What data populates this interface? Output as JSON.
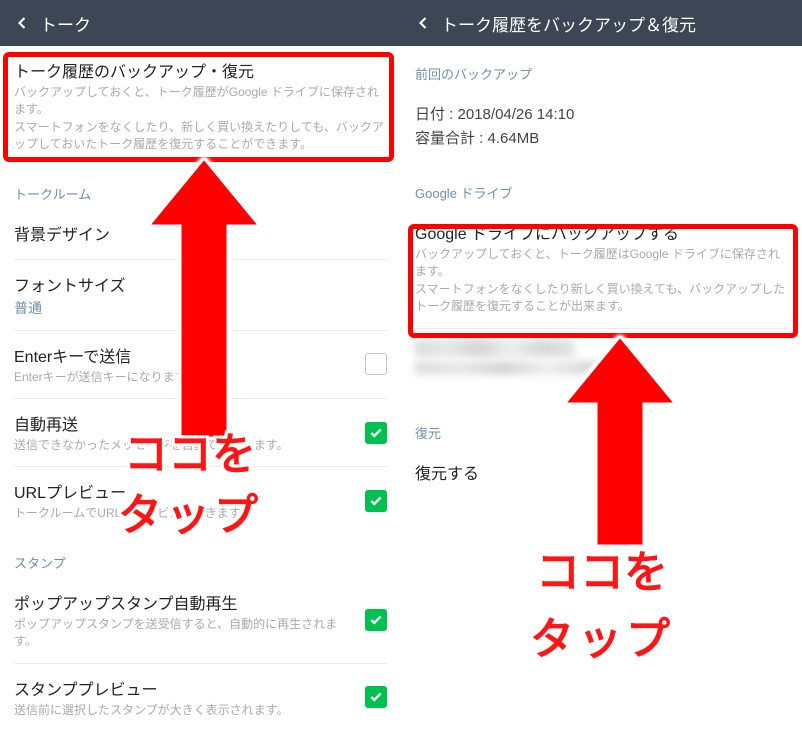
{
  "left": {
    "headerTitle": "トーク",
    "backupItem": {
      "title": "トーク履歴のバックアップ・復元",
      "desc": "バックアップしておくと、トーク履歴がGoogle ドライブに保存されます。\nスマートフォンをなくしたり、新しく買い換えたりしても、バックアップしておいたトーク履歴を復元することができます。"
    },
    "sections": {
      "talkroom": "トークルーム",
      "stamp": "スタンプ"
    },
    "items": {
      "background": {
        "title": "背景デザイン"
      },
      "font": {
        "title": "フォントサイズ",
        "value": "普通"
      },
      "enterKey": {
        "title": "Enterキーで送信",
        "desc": "Enterキーが送信キーになります。"
      },
      "autoResend": {
        "title": "自動再送",
        "desc": "送信できなかったメッセージを自動で再送します。"
      },
      "urlPreview": {
        "title": "URLプレビュー",
        "desc": "トークルームでURLのプレビューできます。"
      },
      "popupStamp": {
        "title": "ポップアップスタンプ自動再生",
        "desc": "ポップアップスタンプを送受信すると、自動的に再生されます。"
      },
      "stampPreview": {
        "title": "スタンププレビュー",
        "desc": "送信前に選択したスタンプが大きく表示されます。"
      }
    }
  },
  "right": {
    "headerTitle": "トーク履歴をバックアップ＆復元",
    "sections": {
      "lastBackup": "前回のバックアップ",
      "googleDrive": "Google ドライブ",
      "restore": "復元"
    },
    "info": {
      "dateLabel": "日付",
      "dateValue": "2018/04/26 14:10",
      "sizeLabel": "容量合計",
      "sizeValue": "4.64MB"
    },
    "backupToDrive": {
      "title": "Google ドライブにバックアップする",
      "desc": "バックアップしておくと、トーク履歴はGoogle ドライブに保存されます。\nスマートフォンをなくしたり新しく買い換えても、バックアップしたトーク履歴を復元することが出来ます。"
    },
    "restoreItem": {
      "title": "復元する"
    }
  },
  "annotation": {
    "line1": "ココを",
    "line2": "タップ"
  }
}
